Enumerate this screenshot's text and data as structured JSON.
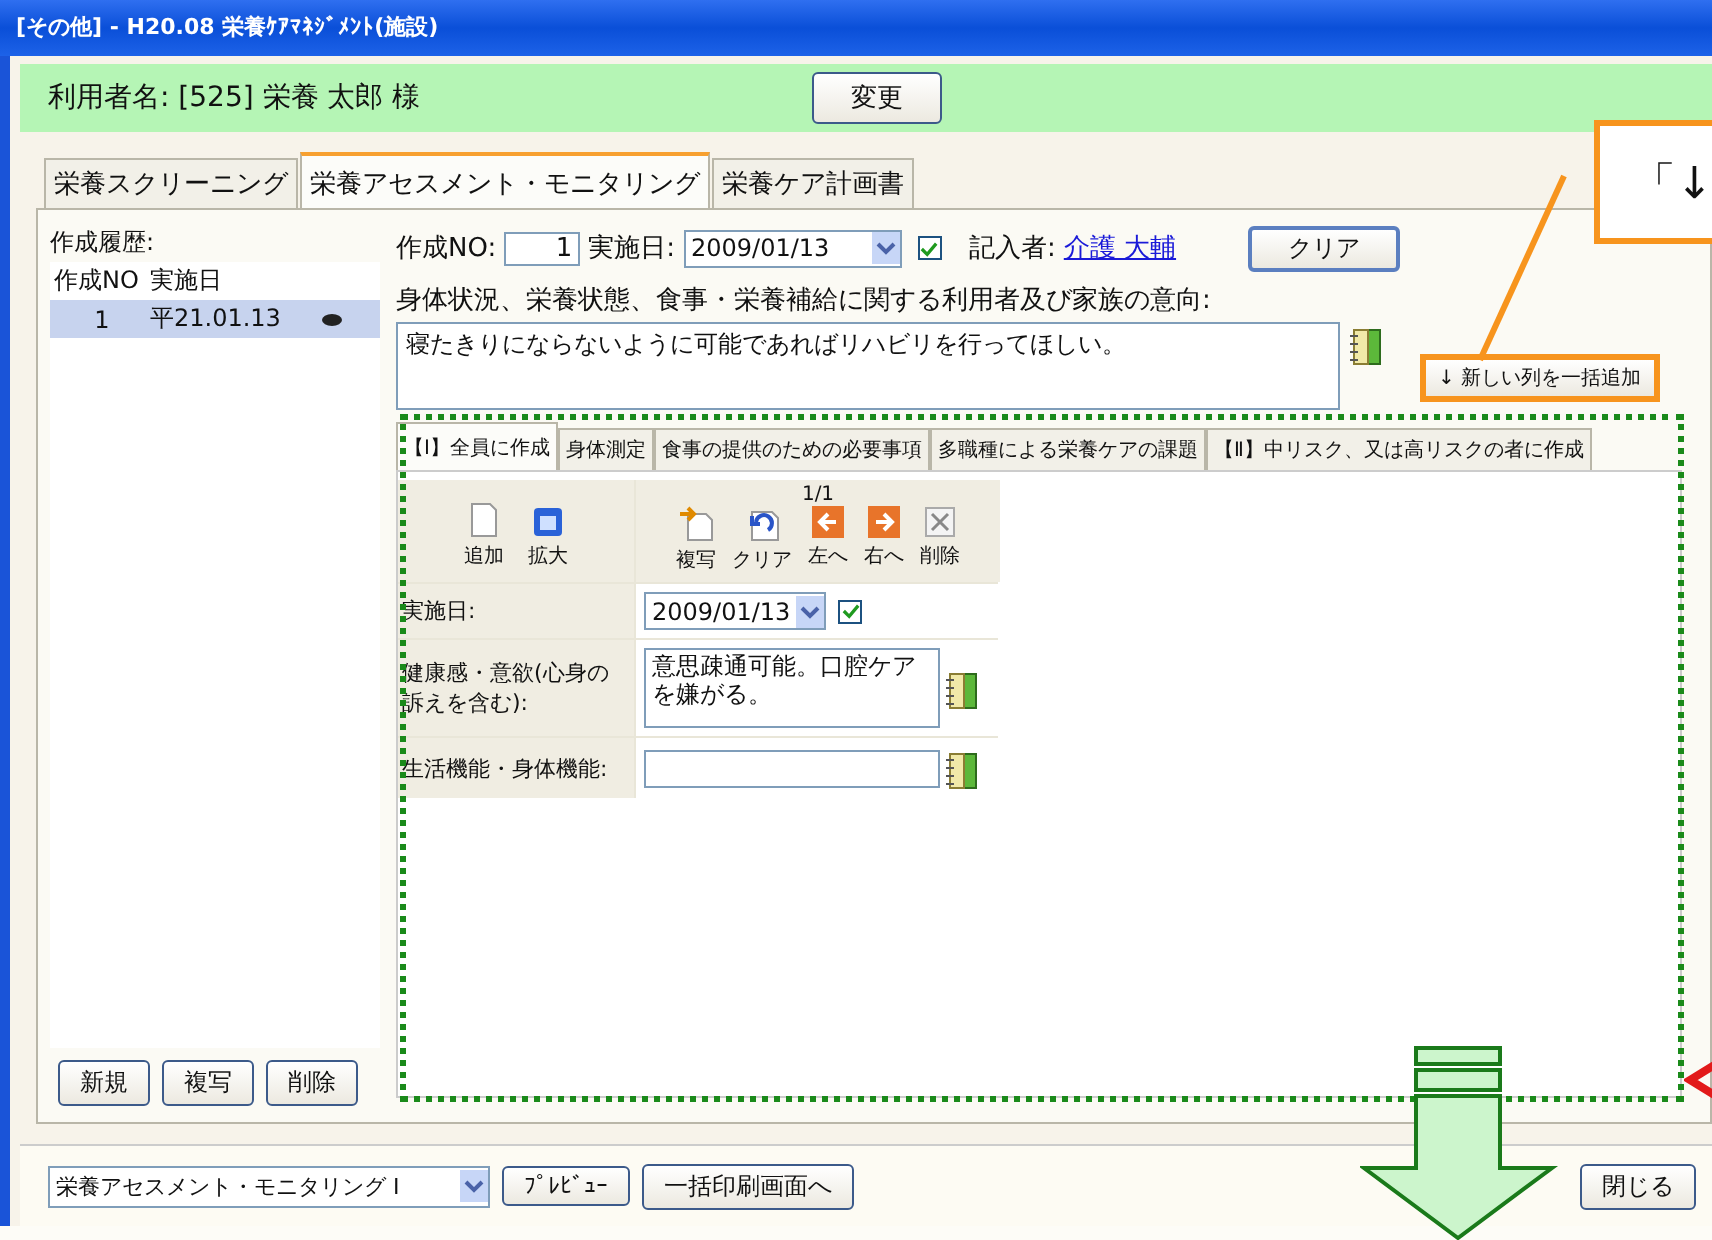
{
  "window": {
    "title": "[その他] - H20.08 栄養ｹｱﾏﾈｼﾞﾒﾝﾄ(施設)"
  },
  "user_bar": {
    "label": "利用者名:",
    "id": "[525]",
    "name": "栄養 太郎 様",
    "button": "変更"
  },
  "tabs": [
    {
      "label": "栄養スクリーニング",
      "selected": false
    },
    {
      "label": "栄養アセスメント・モニタリング",
      "selected": true
    },
    {
      "label": "栄養ケア計画書",
      "selected": false
    }
  ],
  "history": {
    "label": "作成履歴:",
    "columns": [
      "作成NO",
      "実施日"
    ],
    "rows": [
      {
        "no": "1",
        "date": "平21.01.13",
        "selected": true
      }
    ],
    "buttons": [
      "新規",
      "複写",
      "削除"
    ]
  },
  "form": {
    "no_label": "作成NO:",
    "no": "1",
    "date_label": "実施日:",
    "date": "2009/01/13",
    "date_checked": true,
    "writer_label": "記入者:",
    "writer": "介護 大輔",
    "clear": "クリア",
    "intent_label": "身体状況、栄養状態、食事・栄養補給に関する利用者及び家族の意向:",
    "intent": "寝たきりにならないように可能であればリハビリを行ってほしい。",
    "bulk_add": "↓ 新しい列を一括追加"
  },
  "inner_tabs": [
    {
      "label": "【Ⅰ】全員に作成",
      "selected": true
    },
    {
      "label": "身体測定",
      "selected": false
    },
    {
      "label": "食事の提供のための必要事項",
      "selected": false
    },
    {
      "label": "多職種による栄養ケアの課題",
      "selected": false
    },
    {
      "label": "【Ⅱ】中リスク、又は高リスクの者に作成",
      "selected": false
    }
  ],
  "toolbar": {
    "page": "1/1",
    "left": [
      {
        "kind": "add",
        "label": "追加"
      },
      {
        "kind": "expand",
        "label": "拡大"
      }
    ],
    "right": [
      {
        "kind": "copy",
        "label": "複写"
      },
      {
        "kind": "clear",
        "label": "クリア"
      },
      {
        "kind": "left",
        "label": "左へ"
      },
      {
        "kind": "right",
        "label": "右へ"
      },
      {
        "kind": "delete",
        "label": "削除"
      }
    ]
  },
  "rows": [
    {
      "kind": "date",
      "label": "実施日:",
      "value": "2009/01/13",
      "checked": true
    },
    {
      "kind": "textarea",
      "label": "健康感・意欲(心身の訴えを含む):",
      "value": "意思疎通可能。口腔ケアを嫌がる。"
    },
    {
      "kind": "input",
      "label": "生活機能・身体機能:"
    }
  ],
  "footer": {
    "select": "栄養アセスメント・モニタリング Ⅰ",
    "buttons": [
      "ﾌﾟﾚﾋﾞｭｰ",
      "一括印刷画面へ"
    ],
    "close": "閉じる"
  },
  "callout": {
    "text": "「↓"
  }
}
